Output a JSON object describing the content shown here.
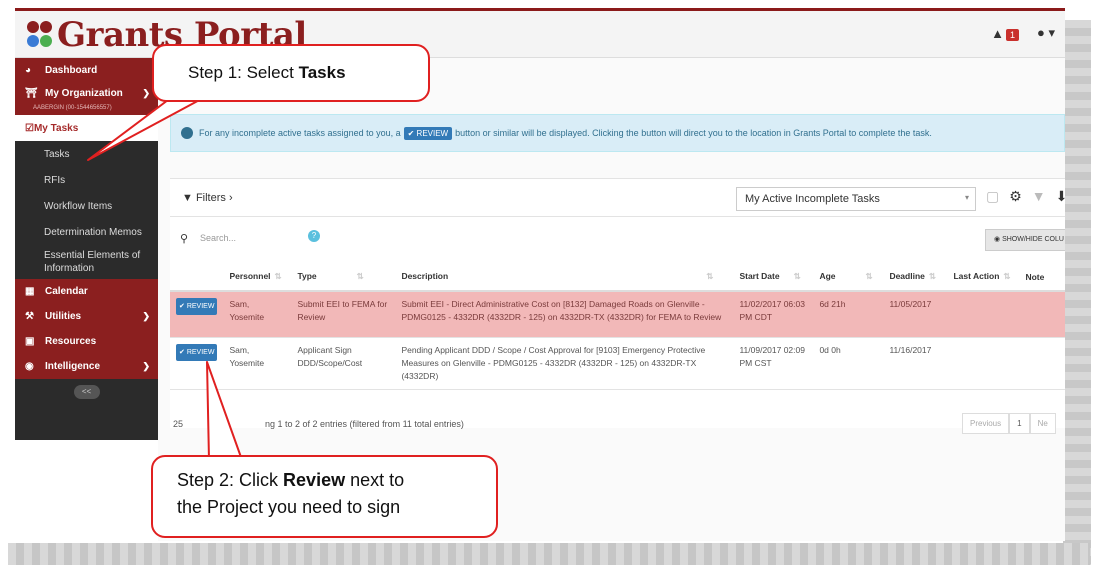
{
  "app": {
    "title": "Grants Portal",
    "notification_count": "1"
  },
  "sidebar": {
    "items": [
      {
        "label": "Dashboard",
        "icon": "dashboard-icon"
      },
      {
        "label": "My Organization",
        "icon": "bank-icon",
        "sub": "AABERGIN (00-1544656557)"
      },
      {
        "label": "My Tasks",
        "icon": "checkbox-icon"
      },
      {
        "label": "Tasks"
      },
      {
        "label": "RFIs"
      },
      {
        "label": "Workflow Items"
      },
      {
        "label": "Determination Memos"
      },
      {
        "label": "Essential Elements of Information"
      },
      {
        "label": "Calendar",
        "icon": "calendar-icon"
      },
      {
        "label": "Utilities",
        "icon": "wrench-icon"
      },
      {
        "label": "Resources",
        "icon": "resources-icon"
      },
      {
        "label": "Intelligence",
        "icon": "eye-icon"
      }
    ],
    "collapse": "<<"
  },
  "info": {
    "before": "For any incomplete active tasks assigned to you, a",
    "button": "REVIEW",
    "after": "button or similar will be displayed. Clicking the button will direct you to the location in Grants Portal to complete the task."
  },
  "toolbar": {
    "filters": "Filters ›",
    "view": "My Active Incomplete Tasks",
    "search_placeholder": "Search...",
    "show_hide": "SHOW/HIDE COLU"
  },
  "table": {
    "headers": [
      "Personnel",
      "Type",
      "Description",
      "Start Date",
      "Age",
      "Deadline",
      "Last Action",
      "Note"
    ],
    "rows": [
      {
        "action": "REVIEW",
        "personnel": "Sam, Yosemite",
        "type": "Submit EEI to FEMA for Review",
        "description": "Submit EEI - Direct Administrative Cost on [8132] Damaged Roads on Glenville - PDMG0125 - 4332DR (4332DR - 125) on 4332DR-TX (4332DR) for FEMA to Review",
        "start": "11/02/2017 06:03 PM CDT",
        "age": "6d 21h",
        "deadline": "11/05/2017"
      },
      {
        "action": "REVIEW",
        "personnel": "Sam, Yosemite",
        "type": "Applicant Sign DDD/Scope/Cost",
        "description": "Pending Applicant DDD / Scope / Cost Approval for [9103] Emergency Protective Measures on Glenville - PDMG0125 - 4332DR (4332DR - 125) on 4332DR-TX (4332DR)",
        "start": "11/09/2017 02:09 PM CST",
        "age": "0d 0h",
        "deadline": "11/16/2017"
      }
    ]
  },
  "footer": {
    "length": "25",
    "entries": "ng 1 to 2 of 2 entries (filtered from 11 total entries)",
    "pager": [
      "Previous",
      "1",
      "Ne"
    ]
  },
  "callouts": {
    "step1_prefix": "Step 1: Select ",
    "step1_bold": "Tasks",
    "step2_prefix": "Step 2: Click ",
    "step2_bold": "Review",
    "step2_suffix": " next to",
    "step2_line2": "the Project you need to sign"
  },
  "colors": {
    "brand": "#8b1f1f",
    "sidebar": "#2b2b2b",
    "highlight_row": "#f2b8b8",
    "button": "#337ab7",
    "callout_border": "#e02020"
  }
}
